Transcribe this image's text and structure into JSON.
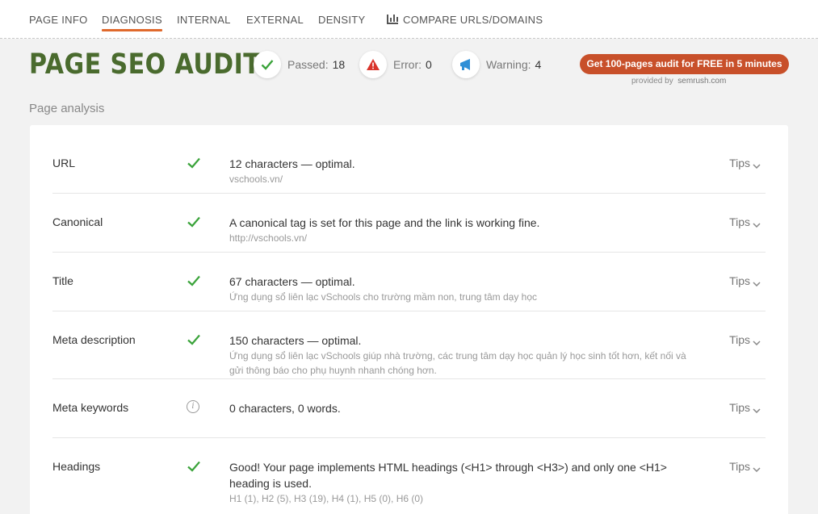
{
  "nav": {
    "items": [
      "PAGE INFO",
      "DIAGNOSIS",
      "INTERNAL",
      "EXTERNAL",
      "DENSITY",
      "COMPARE URLS/DOMAINS"
    ],
    "active": "DIAGNOSIS"
  },
  "header": {
    "title": "PAGE SEO AUDIT",
    "passed_label": "Passed:",
    "passed_count": "18",
    "error_label": "Error:",
    "error_count": "0",
    "warning_label": "Warning:",
    "warning_count": "4",
    "cta_label": "Get 100-pages audit for FREE in 5 minutes",
    "provided_by": "provided by",
    "provider": "semrush.com"
  },
  "colors": {
    "title_green": "#4a6b2e",
    "accent_orange": "#e0692c",
    "cta_red": "#c8502a",
    "check_green": "#3aa33a",
    "error_red": "#d9342b",
    "warning_blue": "#2f8fd6"
  },
  "section_label": "Page analysis",
  "rows": [
    {
      "name": "URL",
      "status": "check-icon",
      "desc": "12 characters — optimal.",
      "sub": "vschools.vn/",
      "tips": "Tips"
    },
    {
      "name": "Canonical",
      "status": "check-icon",
      "desc": "A canonical tag is set for this page and the link is working fine.",
      "sub": "http://vschools.vn/",
      "tips": "Tips"
    },
    {
      "name": "Title",
      "status": "check-icon",
      "desc": "67 characters — optimal.",
      "sub": "Ứng dụng sổ liên lạc vSchools cho trường mầm non, trung tâm dạy học",
      "tips": "Tips"
    },
    {
      "name": "Meta description",
      "status": "check-icon",
      "desc": "150 characters — optimal.",
      "sub": "Ứng dụng sổ liên lạc vSchools giúp nhà trường, các trung tâm dạy học quản lý học sinh tốt hơn, kết nối và gửi thông báo cho phụ huynh nhanh chóng hơn.",
      "tips": "Tips"
    },
    {
      "name": "Meta keywords",
      "status": "info-icon",
      "desc": "0 characters, 0 words.",
      "sub": "",
      "tips": "Tips"
    },
    {
      "name": "Headings",
      "status": "check-icon",
      "desc": "Good! Your page implements HTML headings (<H1> through <H3>) and only one <H1> heading is used.",
      "sub": "H1 (1), H2 (5), H3 (19), H4 (1), H5 (0), H6 (0)",
      "tips": "Tips"
    }
  ]
}
